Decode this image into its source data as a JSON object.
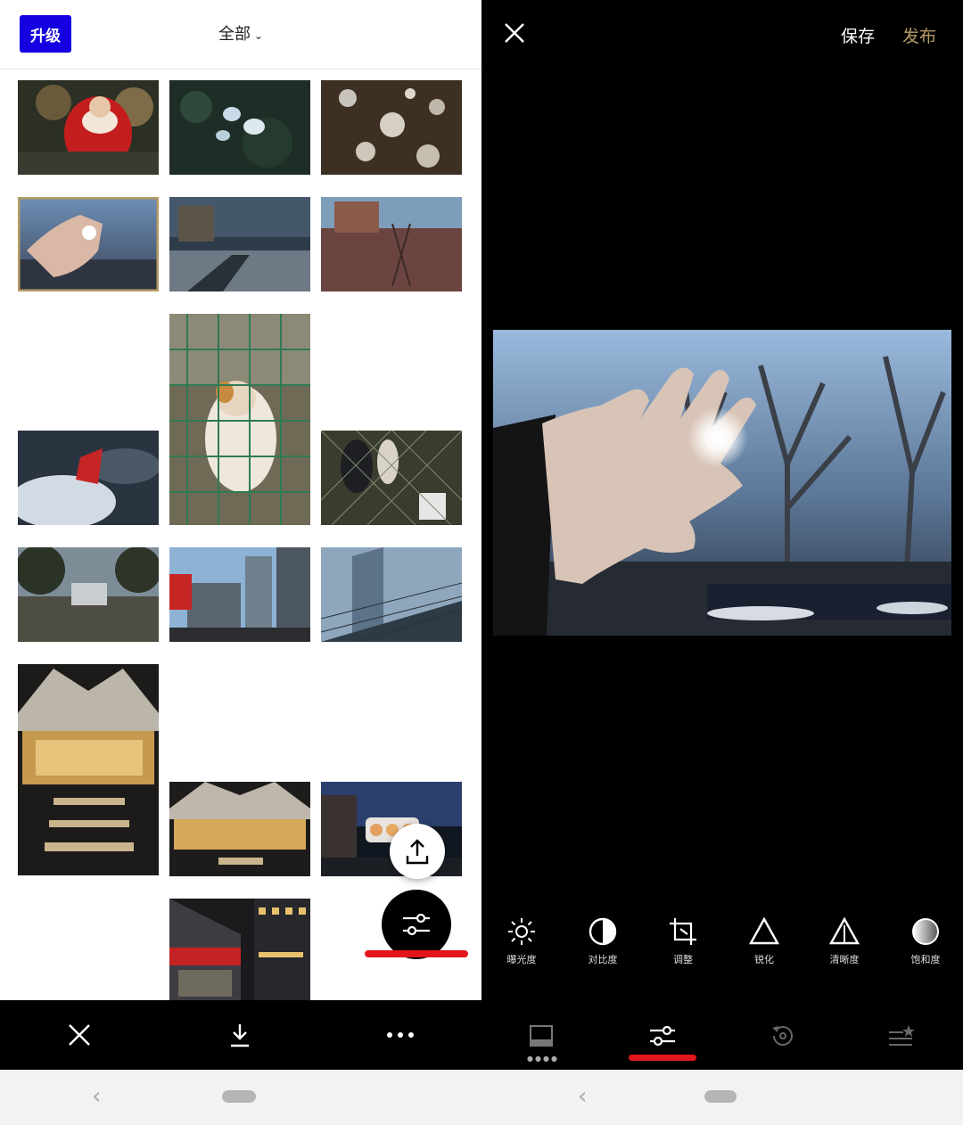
{
  "left": {
    "upgrade_label": "升级",
    "filter_label": "全部",
    "filter_chevron": "chevron-down-icon",
    "thumbnails": [
      {
        "name": "santa-toys",
        "selected": false
      },
      {
        "name": "leaves-ice",
        "selected": false
      },
      {
        "name": "snowy-ground",
        "selected": false
      },
      {
        "name": "hand-sun",
        "selected": true
      },
      {
        "name": "street-shadows",
        "selected": false
      },
      {
        "name": "brick-wall",
        "selected": false
      },
      {
        "name": "cat-fence",
        "selected": false
      },
      {
        "name": "red-flag-snow",
        "selected": false
      },
      {
        "name": "fence-people",
        "selected": false
      },
      {
        "name": "park",
        "selected": false
      },
      {
        "name": "buildings",
        "selected": false
      },
      {
        "name": "glass-tower",
        "selected": false
      },
      {
        "name": "tent-night",
        "selected": false
      },
      {
        "name": "tent-night-2",
        "selected": false
      },
      {
        "name": "street-night",
        "selected": false
      },
      {
        "name": "shop-night",
        "selected": false
      }
    ],
    "bottom_bar": {
      "close": "close-icon",
      "download": "download-icon",
      "more": "more-icon"
    },
    "fab_share": "share-icon",
    "fab_edit": "sliders-icon"
  },
  "right": {
    "save_label": "保存",
    "publish_label": "发布",
    "tools": [
      {
        "label": "曝光度",
        "icon": "exposure-icon"
      },
      {
        "label": "对比度",
        "icon": "contrast-icon"
      },
      {
        "label": "调整",
        "icon": "crop-icon"
      },
      {
        "label": "锐化",
        "icon": "sharpen-icon"
      },
      {
        "label": "清晰度",
        "icon": "clarity-icon"
      },
      {
        "label": "饱和度",
        "icon": "saturation-icon"
      }
    ],
    "tabs": [
      "presets-icon",
      "tools-icon",
      "history-icon",
      "recipes-icon"
    ],
    "active_tab": 1,
    "colors": {
      "accent": "#b69b64",
      "active_underline": "#e2151c",
      "upgrade_bg": "#1400e0"
    }
  }
}
